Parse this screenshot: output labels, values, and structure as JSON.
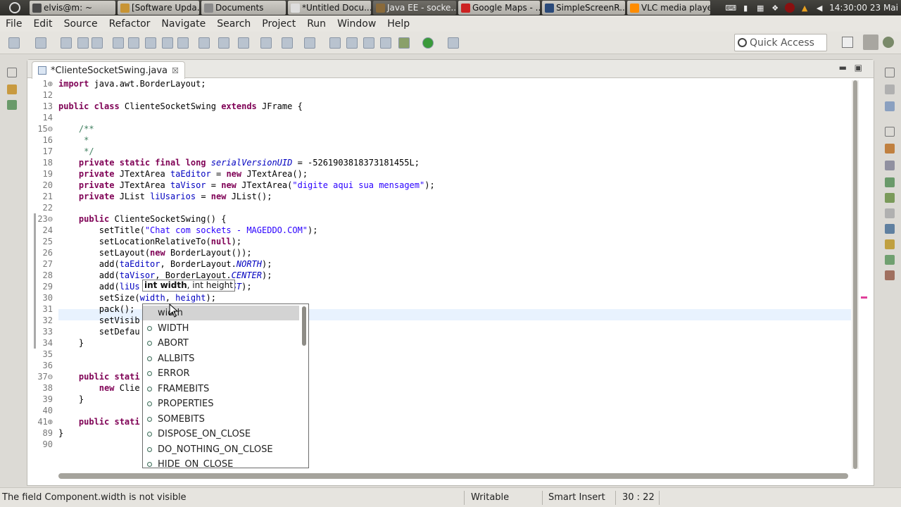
{
  "panel": {
    "tasks": [
      {
        "label": "elvis@m: ~",
        "color": "#4a4a4a"
      },
      {
        "label": "[Software Upda...",
        "color": "#c89434"
      },
      {
        "label": "Documents",
        "color": "#8a8a8a"
      },
      {
        "label": "*Untitled Docu...",
        "color": "#ddd"
      },
      {
        "label": "Java EE - socke...",
        "color": "#8a6a3a"
      },
      {
        "label": "Google Maps - ...",
        "color": "#cc2222"
      },
      {
        "label": "SimpleScreenR...",
        "color": "#2a4a7a"
      },
      {
        "label": "VLC media player",
        "color": "#ff8c00"
      }
    ],
    "clock": "14:30:00 23 Mai"
  },
  "menu": [
    "File",
    "Edit",
    "Source",
    "Refactor",
    "Navigate",
    "Search",
    "Project",
    "Run",
    "Window",
    "Help"
  ],
  "quick_access": {
    "placeholder": "Quick Access"
  },
  "editor": {
    "tab_title": "*ClienteSocketSwing.java",
    "lines": [
      {
        "n": "1",
        "m": "⊕"
      },
      {
        "n": "12"
      },
      {
        "n": "13"
      },
      {
        "n": "14"
      },
      {
        "n": "15",
        "m": "⊖"
      },
      {
        "n": "16"
      },
      {
        "n": "17"
      },
      {
        "n": "18"
      },
      {
        "n": "19"
      },
      {
        "n": "20"
      },
      {
        "n": "21"
      },
      {
        "n": "22"
      },
      {
        "n": "23",
        "m": "⊖"
      },
      {
        "n": "24"
      },
      {
        "n": "25"
      },
      {
        "n": "26"
      },
      {
        "n": "27"
      },
      {
        "n": "28"
      },
      {
        "n": "29"
      },
      {
        "n": "30"
      },
      {
        "n": "31"
      },
      {
        "n": "32"
      },
      {
        "n": "33"
      },
      {
        "n": "34"
      },
      {
        "n": "35"
      },
      {
        "n": "36"
      },
      {
        "n": "37",
        "m": "⊖"
      },
      {
        "n": "38"
      },
      {
        "n": "39"
      },
      {
        "n": "40"
      },
      {
        "n": "41",
        "m": "⊕"
      },
      {
        "n": "89"
      },
      {
        "n": "90"
      }
    ],
    "code": [
      [
        [
          "kw",
          "import"
        ],
        [
          "",
          "java.awt.BorderLayout;"
        ]
      ],
      [],
      [
        [
          "kw",
          "public class"
        ],
        [
          "",
          "ClienteSocketSwing "
        ],
        [
          "kw",
          "extends"
        ],
        [
          "",
          "JFrame {"
        ]
      ],
      [],
      [
        [
          "cmt",
          "    /**"
        ]
      ],
      [
        [
          "cmt",
          "     *"
        ]
      ],
      [
        [
          "cmt",
          "     */"
        ]
      ],
      [
        [
          "kw",
          "    private static final long "
        ],
        [
          "fldi",
          "serialVersionUID"
        ],
        [
          "",
          " = -5261903818373181455L;"
        ]
      ],
      [
        [
          "kw",
          "    private "
        ],
        [
          "",
          "JTextArea "
        ],
        [
          "fld",
          "taEditor"
        ],
        [
          "",
          " = "
        ],
        [
          "kw",
          "new "
        ],
        [
          "",
          "JTextArea();"
        ]
      ],
      [
        [
          "kw",
          "    private "
        ],
        [
          "",
          "JTextArea "
        ],
        [
          "fld",
          "taVisor"
        ],
        [
          "",
          " = "
        ],
        [
          "kw",
          "new "
        ],
        [
          "",
          "JTextArea("
        ],
        [
          "str",
          "\"digite aqui sua mensagem\""
        ],
        [
          "",
          ");"
        ]
      ],
      [
        [
          "kw",
          "    private "
        ],
        [
          "",
          "JList "
        ],
        [
          "fld",
          "liUsarios"
        ],
        [
          "",
          " = "
        ],
        [
          "kw",
          "new "
        ],
        [
          "",
          "JList();"
        ]
      ],
      [],
      [
        [
          "kw",
          "    public "
        ],
        [
          "",
          "ClienteSocketSwing() {"
        ]
      ],
      [
        [
          "",
          "        setTitle("
        ],
        [
          "str",
          "\"Chat com sockets - MAGEDDO.COM\""
        ],
        [
          "",
          ");"
        ]
      ],
      [
        [
          "",
          "        setLocationRelativeTo("
        ],
        [
          "kw",
          "null"
        ],
        [
          "",
          ");"
        ]
      ],
      [
        [
          "",
          "        setLayout("
        ],
        [
          "kw",
          "new "
        ],
        [
          "",
          "BorderLayout());"
        ]
      ],
      [
        [
          "",
          "        add("
        ],
        [
          "fld",
          "taEditor"
        ],
        [
          "",
          ", BorderLayout."
        ],
        [
          "fldi",
          "NORTH"
        ],
        [
          "",
          ");"
        ]
      ],
      [
        [
          "",
          "        add("
        ],
        [
          "fld",
          "taVisor"
        ],
        [
          "",
          ", BorderLayout."
        ],
        [
          "fldi",
          "CENTER"
        ],
        [
          "",
          ");"
        ]
      ],
      [
        [
          "",
          "        add("
        ],
        [
          "fld",
          "liUs"
        ],
        [
          "",
          "              t."
        ],
        [
          "fldi",
          "EAST"
        ],
        [
          "",
          ");"
        ]
      ],
      [
        [
          "",
          "        setSize("
        ],
        [
          "fld",
          "width"
        ],
        [
          "",
          ", "
        ],
        [
          "fld",
          "height"
        ],
        [
          "",
          ");"
        ]
      ],
      [
        [
          "",
          "        pack();"
        ]
      ],
      [
        [
          "",
          "        setVisib"
        ]
      ],
      [
        [
          "",
          "        setDefau"
        ]
      ],
      [
        [
          "",
          "    }"
        ]
      ],
      [],
      [],
      [
        [
          "kw",
          "    public stati"
        ]
      ],
      [
        [
          "",
          "        "
        ],
        [
          "kw",
          "new "
        ],
        [
          "",
          "Clie"
        ]
      ],
      [
        [
          "",
          "    }"
        ]
      ],
      [],
      [
        [
          "kw",
          "    public stati"
        ]
      ],
      [
        [
          "",
          "}"
        ]
      ],
      []
    ]
  },
  "param_hint": {
    "bold": "int width",
    "rest": ", int height"
  },
  "completion": {
    "items": [
      "width",
      "WIDTH",
      "ABORT",
      "ALLBITS",
      "ERROR",
      "FRAMEBITS",
      "PROPERTIES",
      "SOMEBITS",
      "DISPOSE_ON_CLOSE",
      "DO_NOTHING_ON_CLOSE",
      "HIDE_ON_CLOSE"
    ]
  },
  "status": {
    "message": "The field Component.width is not visible",
    "mode": "Writable",
    "insert": "Smart Insert",
    "position": "30 : 22"
  }
}
